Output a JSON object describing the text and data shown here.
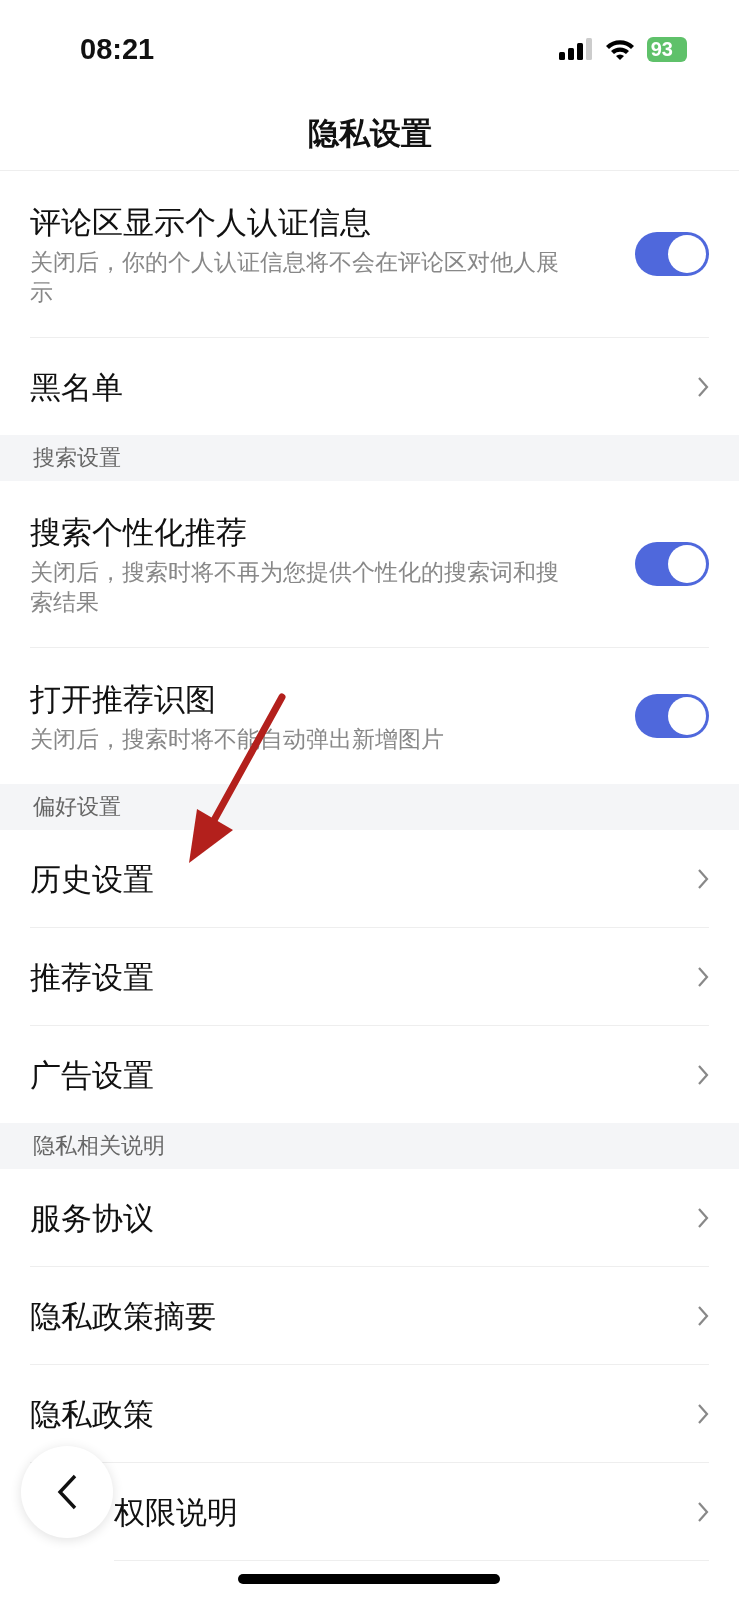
{
  "status_bar": {
    "time": "08:21",
    "battery": "93"
  },
  "title": "隐私设置",
  "sections": [
    {
      "items": [
        {
          "kind": "toggle",
          "label": "评论区显示个人认证信息",
          "description": "关闭后，你的个人认证信息将不会在评论区对他人展示",
          "on": true
        },
        {
          "kind": "link",
          "label": "黑名单"
        }
      ]
    },
    {
      "header": "搜索设置",
      "items": [
        {
          "kind": "toggle",
          "label": "搜索个性化推荐",
          "description": "关闭后，搜索时将不再为您提供个性化的搜索词和搜索结果",
          "on": true
        },
        {
          "kind": "toggle",
          "label": "打开推荐识图",
          "description": "关闭后，搜索时将不能自动弹出新增图片",
          "on": true
        }
      ]
    },
    {
      "header": "偏好设置",
      "items": [
        {
          "kind": "link",
          "label": "历史设置"
        },
        {
          "kind": "link",
          "label": "推荐设置"
        },
        {
          "kind": "link",
          "label": "广告设置"
        }
      ]
    },
    {
      "header": "隐私相关说明",
      "items": [
        {
          "kind": "link",
          "label": "服务协议"
        },
        {
          "kind": "link",
          "label": "隐私政策摘要"
        },
        {
          "kind": "link",
          "label": "隐私政策"
        },
        {
          "kind": "link",
          "label": "权限说明"
        }
      ]
    }
  ]
}
